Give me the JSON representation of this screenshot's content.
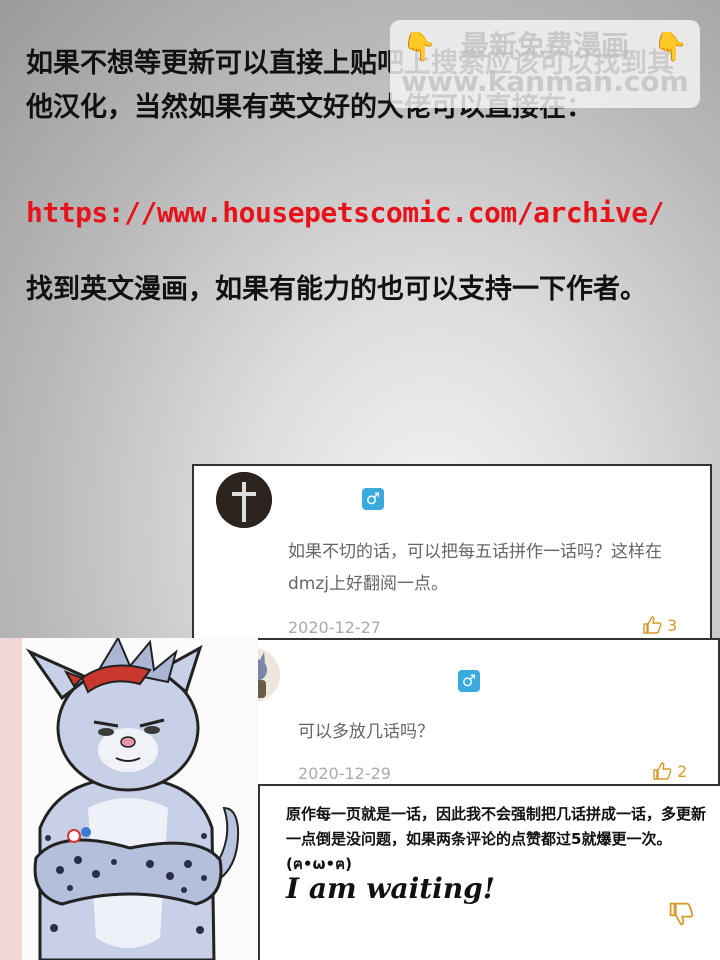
{
  "intro": {
    "line1": "如果不想等更新可以直接上贴吧上搜索应该可以找到其他汉化，当然如果有英文好的大佬可以直接在：",
    "url": "https://www.housepetscomic.com/archive/",
    "line2": "找到英文漫画，如果有能力的也可以支持一下作者。"
  },
  "watermark": {
    "text": "最新免费漫画 www.kanman.com",
    "hand_icon": "hand-pointing-down-icon"
  },
  "comments": [
    {
      "text": "如果不切的话，可以把每五话拼作一话吗？这样在dmzj上好翻阅一点。",
      "date": "2020-12-27",
      "likes": "3",
      "gender": "♂"
    },
    {
      "text": "可以多放几话吗？",
      "date": "2020-12-29",
      "likes": "2",
      "gender": "♂"
    }
  ],
  "reply": {
    "text": "原作每一页就是一话，因此我不会强制把几话拼成一话，多更新一点倒是没问题，如果两条评论的点赞都过5就爆更一次。(ฅ•ω•ฅ)",
    "waiting": "I am waiting!"
  },
  "colors": {
    "url": "#e8121b",
    "gender_badge": "#39a9de",
    "like_icon": "#d89a2c"
  }
}
